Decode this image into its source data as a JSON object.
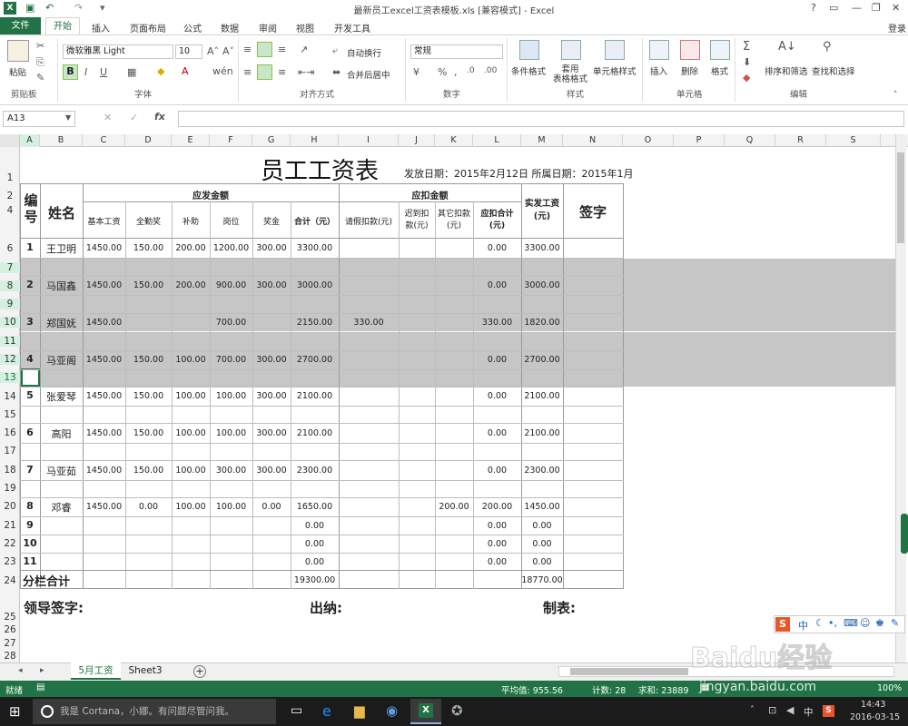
{
  "window": {
    "title": "最新员工excel工资表模板.xls  [兼容模式] - Excel",
    "login": "登录",
    "help": "?"
  },
  "tabs": [
    "文件",
    "开始",
    "插入",
    "页面布局",
    "公式",
    "数据",
    "审阅",
    "视图",
    "开发工具"
  ],
  "ribbon": {
    "paste": "粘贴",
    "clipboard": "剪贴板",
    "font_name": "微软雅黑 Light",
    "font_size": "10",
    "font_group": "字体",
    "wrap": "自动换行",
    "merge": "合并后居中",
    "align_group": "对齐方式",
    "number_format": "常规",
    "number_group": "数字",
    "cond_format": "条件格式",
    "table_format": "套用\n表格格式",
    "cell_style": "单元格样式",
    "styles_group": "样式",
    "insert": "插入",
    "delete": "删除",
    "format": "格式",
    "cells_group": "单元格",
    "sort_filter": "排序和筛选",
    "find_select": "查找和选择",
    "edit_group": "编辑"
  },
  "namebox": "A13",
  "columns": [
    "A",
    "B",
    "C",
    "D",
    "E",
    "F",
    "G",
    "H",
    "I",
    "J",
    "K",
    "L",
    "M",
    "N",
    "O",
    "P",
    "Q",
    "R",
    "S"
  ],
  "rows": [
    "1",
    "2",
    "4",
    "6",
    "7",
    "8",
    "9",
    "10",
    "11",
    "12",
    "13",
    "14",
    "15",
    "16",
    "17",
    "18",
    "19",
    "20",
    "21",
    "22",
    "23",
    "24",
    "25",
    "26",
    "27",
    "28"
  ],
  "sheet": {
    "title": "员工工资表",
    "issue_date": "发放日期：2015年2月12日  所属日期：2015年1月",
    "hdr_no": "编\n号",
    "hdr_name": "姓名",
    "hdr_payable": "应发金额",
    "hdr_deduct": "应扣金额",
    "hdr_net": "实发工资\n(元)",
    "hdr_sign": "签字",
    "sub_payable": [
      "基本工资",
      "全勤奖",
      "补助",
      "岗位",
      "奖金",
      "合计（元）"
    ],
    "sub_deduct": [
      "请假扣款(元)",
      "迟到扣\n款(元)",
      "其它扣款\n(元)",
      "应扣合计\n(元)"
    ],
    "data": [
      {
        "no": "1",
        "name": "王卫明",
        "base": "1450.00",
        "attend": "150.00",
        "subsidy": "200.00",
        "post": "1200.00",
        "bonus": "300.00",
        "total": "3300.00",
        "leave": "",
        "late": "",
        "other": "",
        "dtotal": "0.00",
        "net": "3300.00"
      },
      {
        "no": "2",
        "name": "马国鑫",
        "base": "1450.00",
        "attend": "150.00",
        "subsidy": "200.00",
        "post": "900.00",
        "bonus": "300.00",
        "total": "3000.00",
        "leave": "",
        "late": "",
        "other": "",
        "dtotal": "0.00",
        "net": "3000.00"
      },
      {
        "no": "3",
        "name": "郑国妩",
        "base": "1450.00",
        "attend": "",
        "subsidy": "",
        "post": "700.00",
        "bonus": "",
        "total": "2150.00",
        "leave": "330.00",
        "late": "",
        "other": "",
        "dtotal": "330.00",
        "net": "1820.00"
      },
      {
        "no": "4",
        "name": "马亚阁",
        "base": "1450.00",
        "attend": "150.00",
        "subsidy": "100.00",
        "post": "700.00",
        "bonus": "300.00",
        "total": "2700.00",
        "leave": "",
        "late": "",
        "other": "",
        "dtotal": "0.00",
        "net": "2700.00"
      },
      {
        "no": "5",
        "name": "张爱琴",
        "base": "1450.00",
        "attend": "150.00",
        "subsidy": "100.00",
        "post": "100.00",
        "bonus": "300.00",
        "total": "2100.00",
        "leave": "",
        "late": "",
        "other": "",
        "dtotal": "0.00",
        "net": "2100.00"
      },
      {
        "no": "6",
        "name": "高阳",
        "base": "1450.00",
        "attend": "150.00",
        "subsidy": "100.00",
        "post": "100.00",
        "bonus": "300.00",
        "total": "2100.00",
        "leave": "",
        "late": "",
        "other": "",
        "dtotal": "0.00",
        "net": "2100.00"
      },
      {
        "no": "7",
        "name": "马亚茹",
        "base": "1450.00",
        "attend": "150.00",
        "subsidy": "100.00",
        "post": "300.00",
        "bonus": "300.00",
        "total": "2300.00",
        "leave": "",
        "late": "",
        "other": "",
        "dtotal": "0.00",
        "net": "2300.00"
      },
      {
        "no": "8",
        "name": "邓睿",
        "base": "1450.00",
        "attend": "0.00",
        "subsidy": "100.00",
        "post": "100.00",
        "bonus": "0.00",
        "total": "1650.00",
        "leave": "",
        "late": "",
        "other": "200.00",
        "dtotal": "200.00",
        "net": "1450.00"
      },
      {
        "no": "9",
        "name": "",
        "base": "",
        "attend": "",
        "subsidy": "",
        "post": "",
        "bonus": "",
        "total": "0.00",
        "leave": "",
        "late": "",
        "other": "",
        "dtotal": "0.00",
        "net": "0.00"
      },
      {
        "no": "10",
        "name": "",
        "base": "",
        "attend": "",
        "subsidy": "",
        "post": "",
        "bonus": "",
        "total": "0.00",
        "leave": "",
        "late": "",
        "other": "",
        "dtotal": "0.00",
        "net": "0.00"
      },
      {
        "no": "11",
        "name": "",
        "base": "",
        "attend": "",
        "subsidy": "",
        "post": "",
        "bonus": "",
        "total": "0.00",
        "leave": "",
        "late": "",
        "other": "",
        "dtotal": "0.00",
        "net": "0.00"
      }
    ],
    "subtotal_label": "分栏合计",
    "subtotal_total": "19300.00",
    "subtotal_net": "18770.00",
    "sig_leader": "领导签字:",
    "sig_cashier": "出纳:",
    "sig_maker": "制表:"
  },
  "sheet_tabs": [
    "5月工资",
    "Sheet3"
  ],
  "status": {
    "ready": "就绪",
    "avg": "平均值: 955.56",
    "count": "计数: 28",
    "sum": "求和: 23889",
    "zoom": "100%"
  },
  "taskbar": {
    "cortana": "我是 Cortana，小娜。有问题尽管问我。",
    "time": "14:43",
    "date": "2016-03-15",
    "ime": "中"
  },
  "watermark": "Baidu经验",
  "watermark_url": "jingyan.baidu.com",
  "colors": {
    "excel_green": "#217346",
    "band_gray": "#c6c6c6"
  }
}
